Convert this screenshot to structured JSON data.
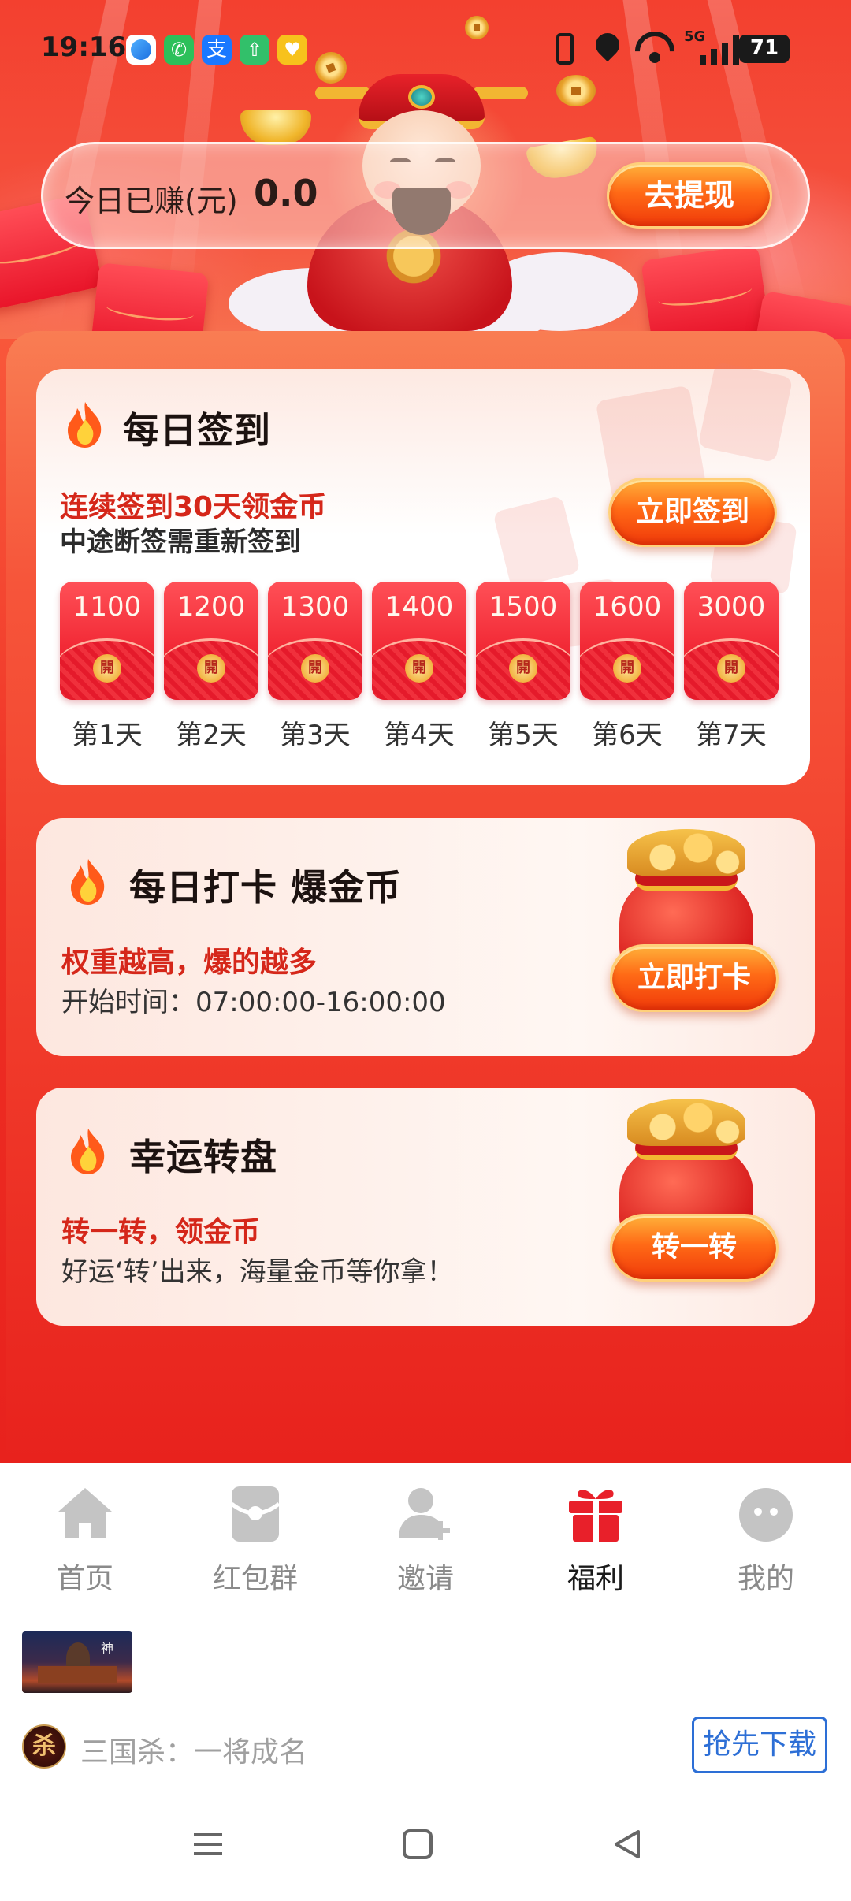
{
  "status_bar": {
    "time": "19:16",
    "app_icons": [
      "browser-icon",
      "phone-icon",
      "alipay-icon",
      "upload-icon",
      "heart-app-icon"
    ],
    "network": "5G",
    "battery": "71"
  },
  "earnings": {
    "label": "今日已赚(元)",
    "value": "0.0",
    "withdraw_button": "去提现"
  },
  "daily_signin": {
    "title": "每日签到",
    "subtitle_red": "连续签到30天领金币",
    "subtitle_dark": "中途断签需重新签到",
    "button": "立即签到",
    "seal_char": "開",
    "rewards": [
      {
        "amount": "1100",
        "day": "第1天"
      },
      {
        "amount": "1200",
        "day": "第2天"
      },
      {
        "amount": "1300",
        "day": "第3天"
      },
      {
        "amount": "1400",
        "day": "第4天"
      },
      {
        "amount": "1500",
        "day": "第5天"
      },
      {
        "amount": "1600",
        "day": "第6天"
      },
      {
        "amount": "3000",
        "day": "第7天"
      }
    ]
  },
  "daily_checkin": {
    "title": "每日打卡 爆金币",
    "subtitle_red": "权重越高，爆的越多",
    "time_label": "开始时间：07:00:00-16:00:00",
    "button": "立即打卡"
  },
  "lucky_wheel": {
    "title": "幸运转盘",
    "subtitle_red": "转一转，领金币",
    "description": "好运‘转’出来，海量金币等你拿！",
    "button": "转一转"
  },
  "bottom_nav": {
    "items": [
      {
        "label": "首页",
        "icon": "home-icon",
        "active": false
      },
      {
        "label": "红包群",
        "icon": "red-packet-icon",
        "active": false
      },
      {
        "label": "邀请",
        "icon": "invite-user-icon",
        "active": false
      },
      {
        "label": "福利",
        "icon": "gift-icon",
        "active": true
      },
      {
        "label": "我的",
        "icon": "profile-icon",
        "active": false
      }
    ]
  },
  "ad": {
    "title": "三国杀：一将成名",
    "avatar_char": "杀",
    "download_button": "抢先下载"
  },
  "colors": {
    "primary_red": "#e8221d",
    "accent_orange": "#ff6a16",
    "active_nav_icon": "#e8202a",
    "ad_button_blue": "#2d6fd6"
  }
}
